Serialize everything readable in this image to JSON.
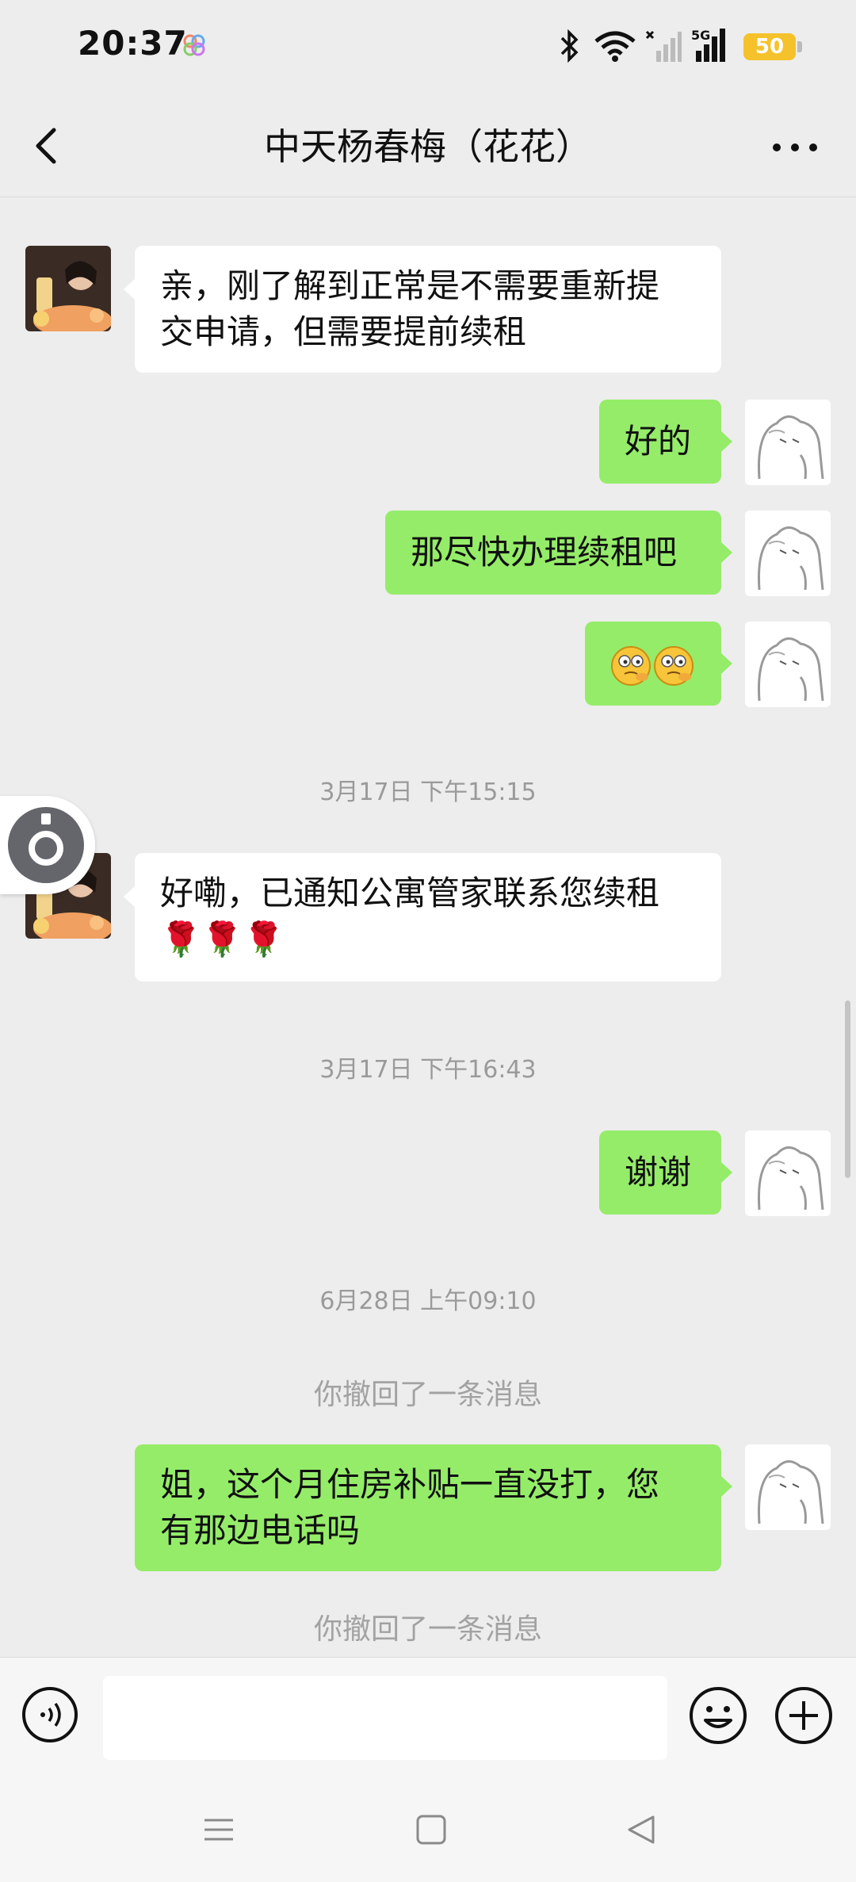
{
  "status_bar": {
    "time": "20:37",
    "battery": "50"
  },
  "header": {
    "title": "中天杨春梅（花花）"
  },
  "messages": [
    {
      "side": "left",
      "text_line1": "亲，刚了解到正常是不需要重新提",
      "text_line2": "交申请，但需要提前续租"
    },
    {
      "side": "right",
      "text": "好的"
    },
    {
      "side": "right",
      "text": "那尽快办理续租吧"
    },
    {
      "side": "right",
      "text": "",
      "emoji": "two-face-emojis"
    },
    {
      "timestamp": "3月17日 下午15:15"
    },
    {
      "side": "left",
      "text_line1": "好嘞，已通知公寓管家联系您续租",
      "text_line2": "🌹🌹🌹"
    },
    {
      "timestamp": "3月17日 下午16:43"
    },
    {
      "side": "right",
      "text": "谢谢"
    },
    {
      "timestamp": "6月28日 上午09:10"
    },
    {
      "system": "你撤回了一条消息"
    },
    {
      "side": "right",
      "text_line1": "姐，这个月住房补贴一直没打，您",
      "text_line2": "有那边电话吗"
    },
    {
      "system": "你撤回了一条消息"
    }
  ],
  "input": {
    "placeholder": ""
  },
  "colors": {
    "green_bubble": "#95ec69",
    "background": "#ededed",
    "battery": "#f5c22b"
  }
}
